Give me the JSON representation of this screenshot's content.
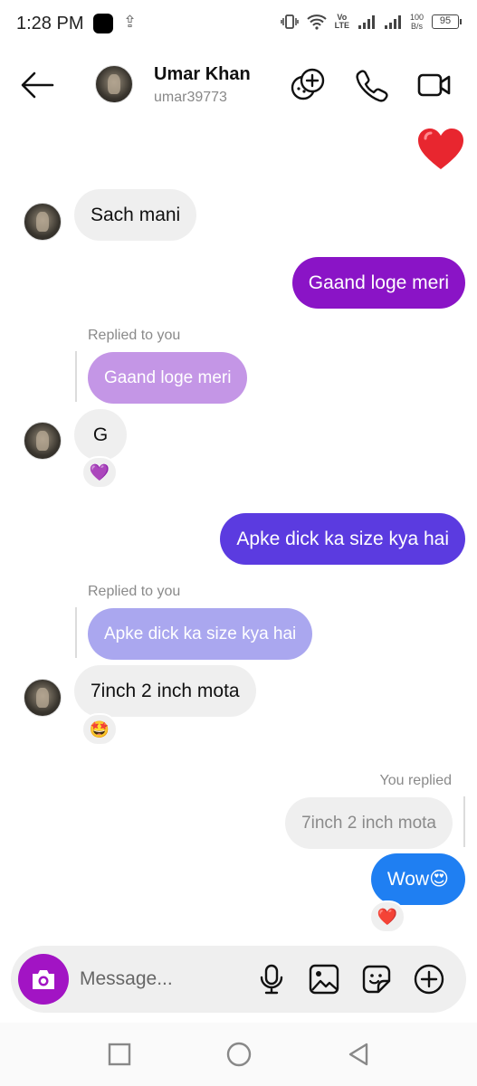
{
  "status_bar": {
    "time": "1:28 PM",
    "volte_top": "Vo",
    "volte_bottom": "LTE",
    "speed_value": "100",
    "speed_unit": "B/s",
    "battery": "95"
  },
  "header": {
    "name": "Umar Khan",
    "username": "umar39773"
  },
  "messages": {
    "m1": "Sach mani",
    "m2": "Gaand loge meri",
    "m3_reply_label": "Replied to you",
    "m3_quote": "Gaand loge meri",
    "m3": "G",
    "m4": "Apke dick ka size kya hai",
    "m5_reply_label": "Replied to you",
    "m5_quote": "Apke dick ka size kya hai",
    "m5": "7inch 2 inch mota",
    "m6_reply_label": "You replied",
    "m6_quote": "7inch 2 inch mota",
    "m6": "Wow😍"
  },
  "reactions": {
    "r_m3": "💜",
    "r_m5": "🤩",
    "r_m6": "❤️"
  },
  "colors": {
    "out_purple": "#8a14c6",
    "out_indigo": "#5b3be0",
    "out_blue": "#1f7ff2",
    "quote_purple": "#c496e6",
    "quote_indigo": "#aaa7ef",
    "camera": "#a214c4"
  },
  "composer": {
    "placeholder": "Message..."
  }
}
